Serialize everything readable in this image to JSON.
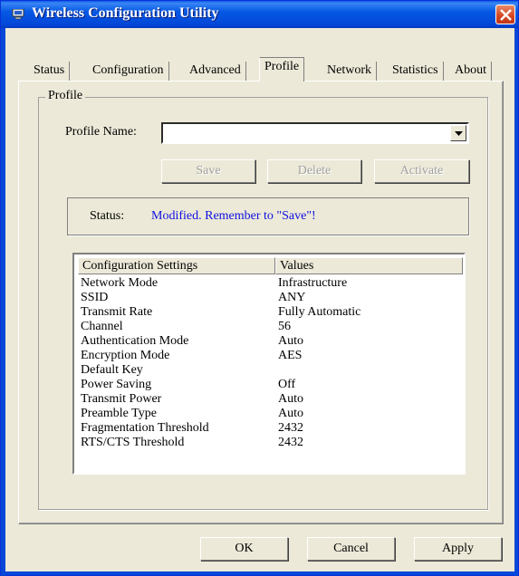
{
  "window": {
    "title": "Wireless Configuration Utility"
  },
  "tabs": [
    {
      "label": "Status"
    },
    {
      "label": "Configuration"
    },
    {
      "label": "Advanced"
    },
    {
      "label": "Profile"
    },
    {
      "label": "Network"
    },
    {
      "label": "Statistics"
    },
    {
      "label": "About"
    }
  ],
  "profile": {
    "group_label": "Profile",
    "name_label": "Profile Name:",
    "name_value": "",
    "save_label": "Save",
    "delete_label": "Delete",
    "activate_label": "Activate",
    "status_label": "Status:",
    "status_value": "Modified. Remember to \"Save\"!"
  },
  "table": {
    "headers": [
      "Configuration Settings",
      "Values"
    ],
    "rows": [
      [
        "Network Mode",
        "Infrastructure"
      ],
      [
        "SSID",
        "ANY"
      ],
      [
        "Transmit Rate",
        "Fully Automatic"
      ],
      [
        "Channel",
        "56"
      ],
      [
        "Authentication Mode",
        "Auto"
      ],
      [
        "Encryption Mode",
        "AES"
      ],
      [
        "Default Key",
        ""
      ],
      [
        "Power Saving",
        "Off"
      ],
      [
        "Transmit Power",
        "Auto"
      ],
      [
        "Preamble Type",
        "Auto"
      ],
      [
        "Fragmentation Threshold",
        "2432"
      ],
      [
        "RTS/CTS Threshold",
        "2432"
      ]
    ]
  },
  "footer": {
    "ok_label": "OK",
    "cancel_label": "Cancel",
    "apply_label": "Apply"
  },
  "colors": {
    "titlebar": "#0558e4",
    "status_text": "#1010e0",
    "face": "#ece9d8",
    "close": "#d5451f"
  }
}
